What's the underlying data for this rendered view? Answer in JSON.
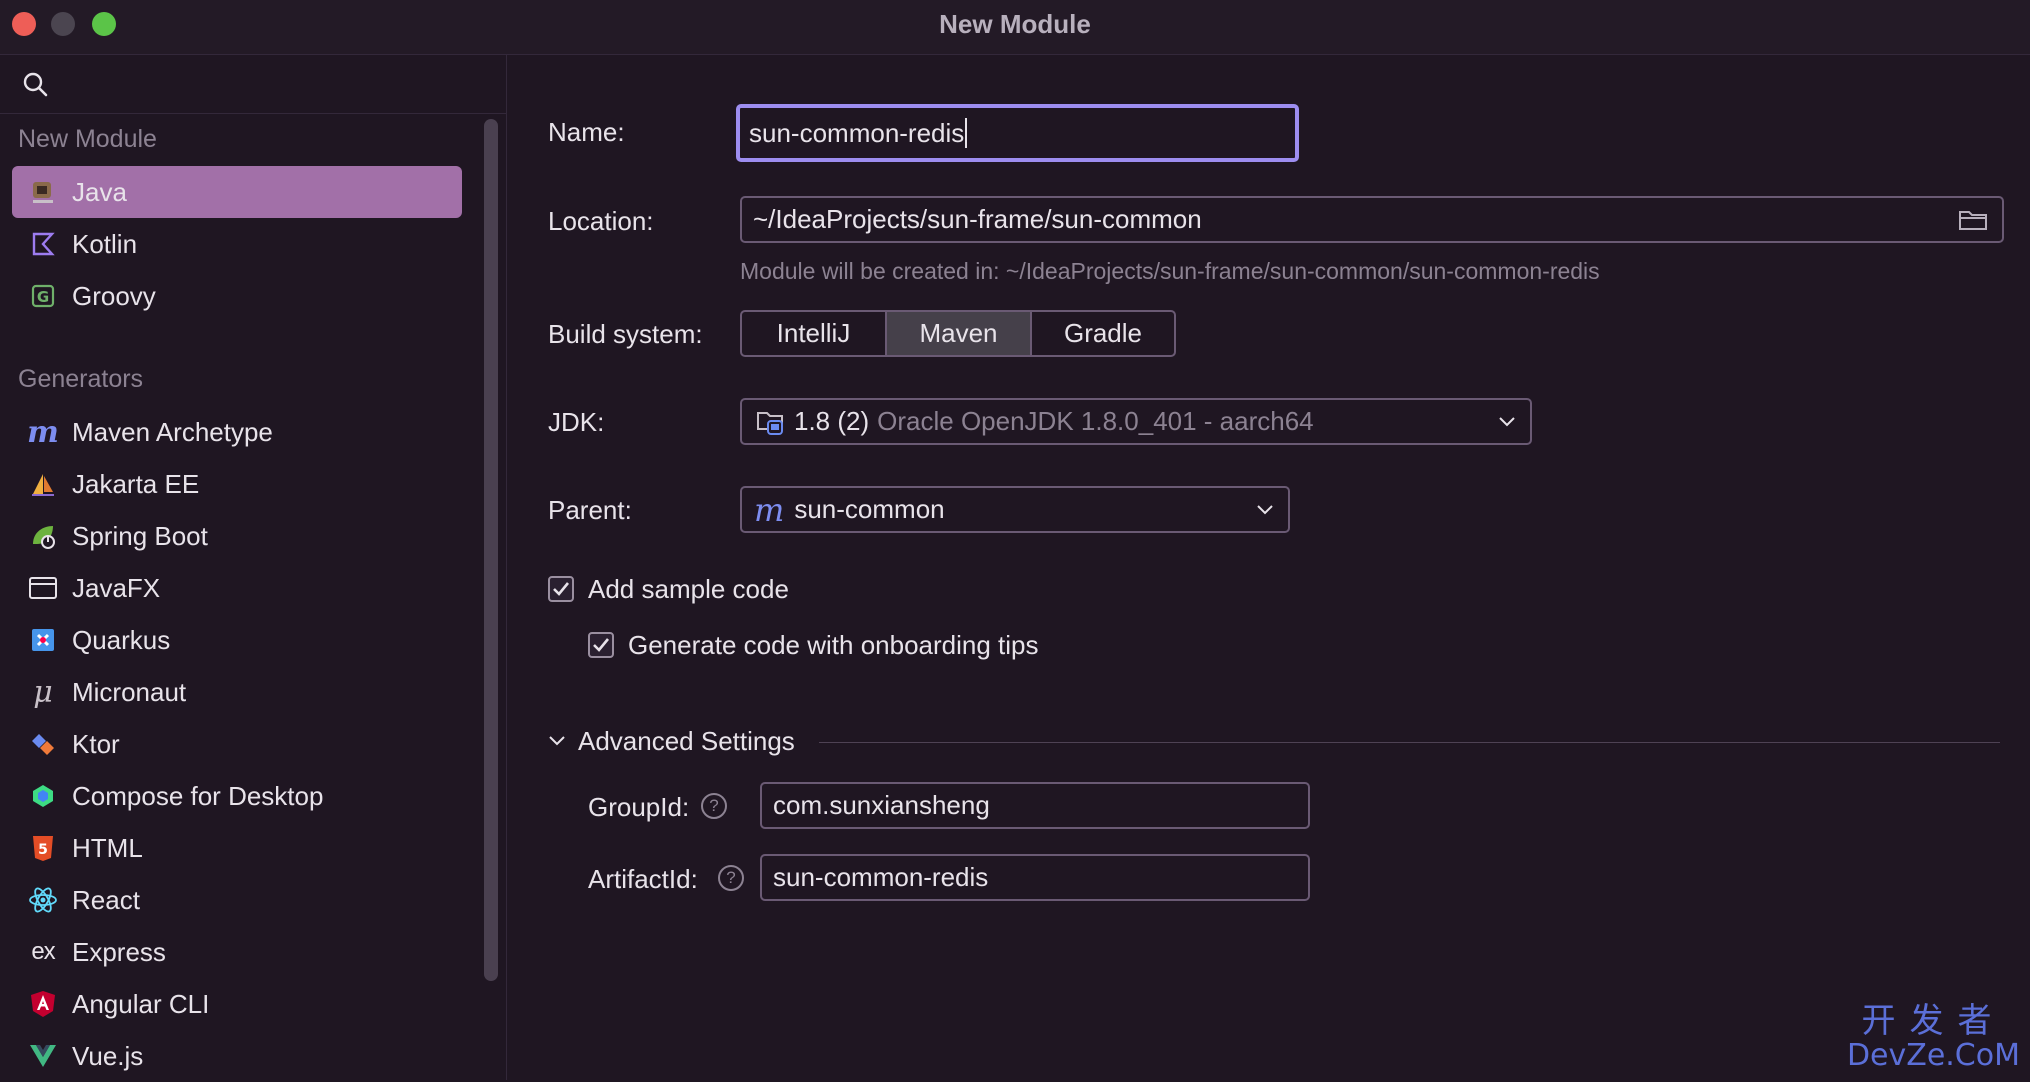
{
  "window": {
    "title": "New Module"
  },
  "sidebar": {
    "group_new_module": "New Module",
    "items": [
      {
        "label": "Java",
        "icon": "java-icon",
        "selected": true
      },
      {
        "label": "Kotlin",
        "icon": "kotlin-icon"
      },
      {
        "label": "Groovy",
        "icon": "groovy-icon"
      }
    ],
    "group_generators": "Generators",
    "generators": [
      {
        "label": "Maven Archetype",
        "icon": "maven-icon"
      },
      {
        "label": "Jakarta EE",
        "icon": "jakarta-ee-icon"
      },
      {
        "label": "Spring Boot",
        "icon": "spring-boot-icon"
      },
      {
        "label": "JavaFX",
        "icon": "javafx-icon"
      },
      {
        "label": "Quarkus",
        "icon": "quarkus-icon"
      },
      {
        "label": "Micronaut",
        "icon": "micronaut-icon"
      },
      {
        "label": "Ktor",
        "icon": "ktor-icon"
      },
      {
        "label": "Compose for Desktop",
        "icon": "compose-icon"
      },
      {
        "label": "HTML",
        "icon": "html-icon"
      },
      {
        "label": "React",
        "icon": "react-icon"
      },
      {
        "label": "Express",
        "icon": "express-icon"
      },
      {
        "label": "Angular CLI",
        "icon": "angular-icon"
      },
      {
        "label": "Vue.js",
        "icon": "vue-icon"
      }
    ]
  },
  "form": {
    "name_label": "Name:",
    "name_value": "sun-common-redis",
    "location_label": "Location:",
    "location_value": "~/IdeaProjects/sun-frame/sun-common",
    "location_hint": "Module will be created in: ~/IdeaProjects/sun-frame/sun-common/sun-common-redis",
    "build_label": "Build system:",
    "build_options": [
      "IntelliJ",
      "Maven",
      "Gradle"
    ],
    "build_selected": "Maven",
    "jdk_label": "JDK:",
    "jdk_version": "1.8 (2)",
    "jdk_detail": "Oracle OpenJDK 1.8.0_401 - aarch64",
    "parent_label": "Parent:",
    "parent_value": "sun-common",
    "sample_code_label": "Add sample code",
    "sample_code_checked": true,
    "onboarding_label": "Generate code with onboarding tips",
    "onboarding_checked": true,
    "advanced_label": "Advanced Settings",
    "groupid_label": "GroupId:",
    "groupid_value": "com.sunxiansheng",
    "artifactid_label": "ArtifactId:",
    "artifactid_value": "sun-common-redis",
    "help_glyph": "?"
  },
  "watermark": {
    "top": "开发者",
    "bottom": "DevZe.CoM"
  },
  "colors": {
    "accent": "#9d8df0",
    "selection": "#a270a8",
    "background": "#1f1622"
  }
}
